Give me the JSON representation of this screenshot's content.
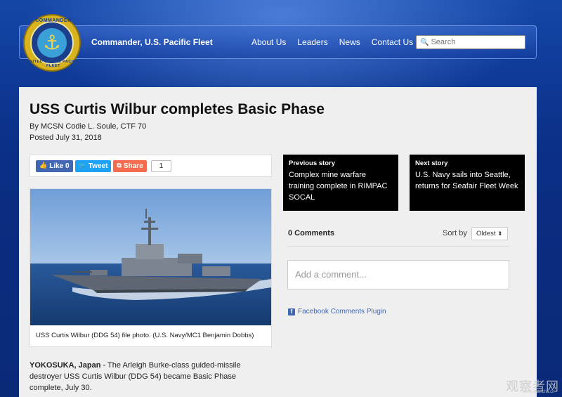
{
  "header": {
    "logo_text_top": "COMMANDER",
    "logo_text_bottom": "UNITED STATES PACIFIC FLEET",
    "site_title": "Commander, U.S. Pacific Fleet",
    "nav": [
      "About Us",
      "Leaders",
      "News",
      "Contact Us"
    ],
    "search_placeholder": "Search"
  },
  "article": {
    "title": "USS Curtis Wilbur completes Basic Phase",
    "byline": "By MCSN Codie L. Soule, CTF 70",
    "posted": "Posted July 31, 2018",
    "share": {
      "like_label": "Like 0",
      "tweet_label": "Tweet",
      "share_label": "Share",
      "share_count": "1"
    },
    "photo_caption": "USS Curtis Wilbur (DDG 54) file photo. (U.S. Navy/MC1 Benjamin Dobbs)",
    "dateline": "YOKOSUKA, Japan",
    "body_rest": " - The Arleigh Burke-class guided-missile destroyer USS Curtis Wilbur (DDG 54) became Basic Phase complete, July 30."
  },
  "prev_story": {
    "label": "Previous story",
    "title": "Complex mine warfare training complete in RIMPAC SOCAL"
  },
  "next_story": {
    "label": "Next story",
    "title": "U.S. Navy sails into Seattle, returns for Seafair Fleet Week"
  },
  "comments": {
    "count_label": "0 Comments",
    "sort_by_label": "Sort by",
    "sort_selected": "Oldest",
    "comment_placeholder": "Add a comment...",
    "plugin_label": "Facebook Comments Plugin"
  },
  "watermark": {
    "text": "观察者网",
    "sub": "www.guancha.cn"
  }
}
